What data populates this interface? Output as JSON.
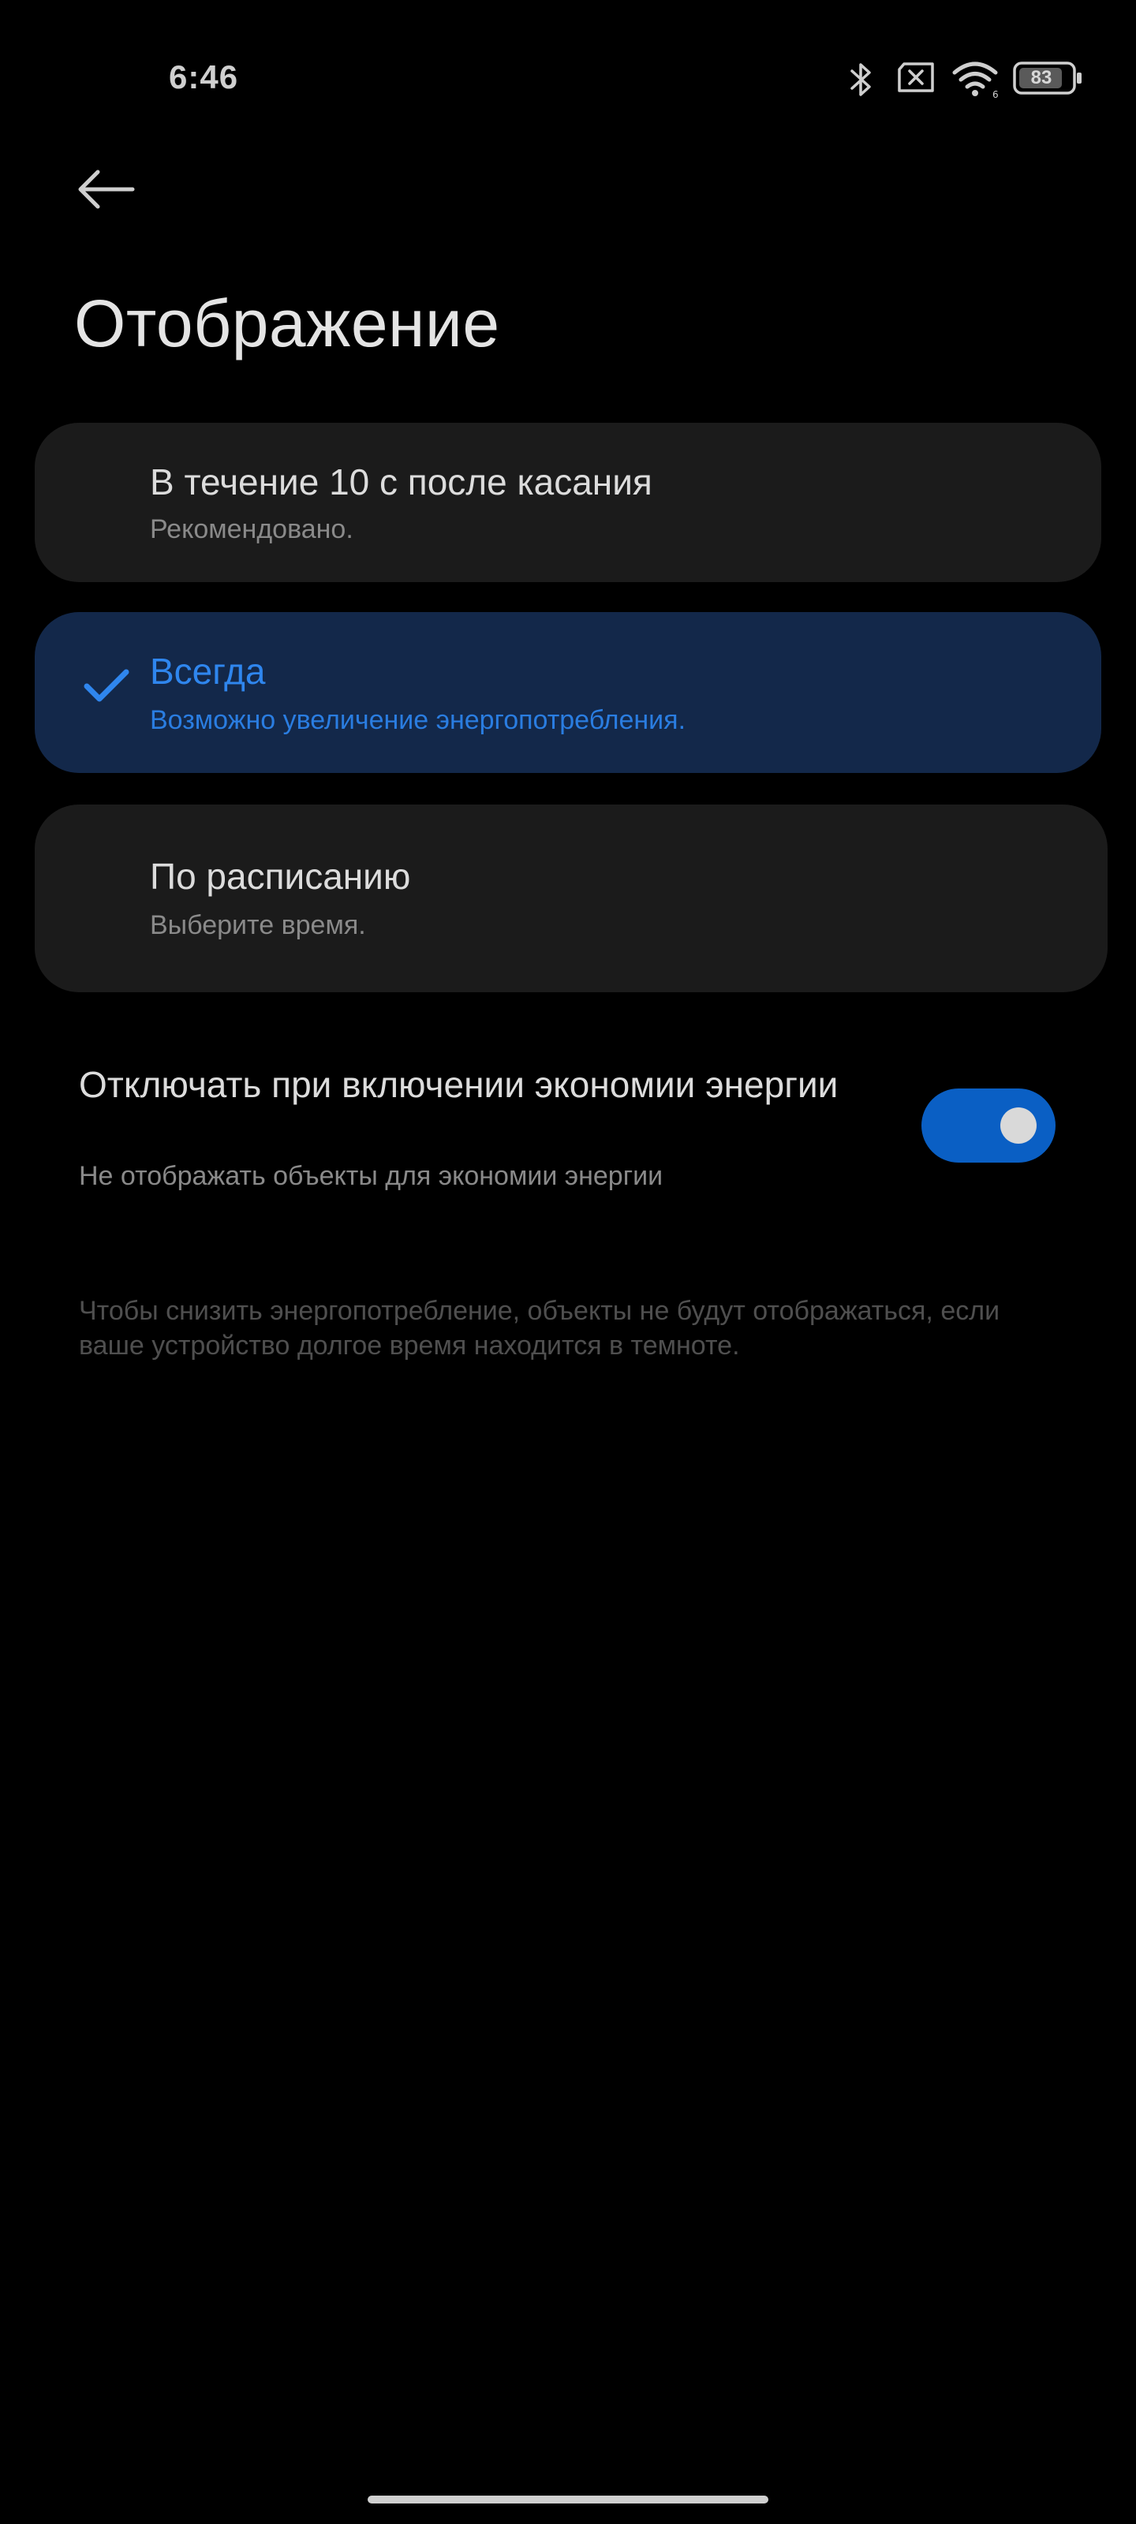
{
  "status_bar": {
    "time": "6:46",
    "battery_level": "83",
    "icons": [
      "bluetooth-icon",
      "no-sim-icon",
      "wifi-icon",
      "battery-icon"
    ]
  },
  "header": {
    "back_icon": "arrow-left-icon",
    "title": "Отображение"
  },
  "options": [
    {
      "title": "В течение 10 с после касания",
      "subtitle": "Рекомендовано.",
      "selected": false
    },
    {
      "title": "Всегда",
      "subtitle": "Возможно увеличение энергопотребления.",
      "selected": true
    },
    {
      "title": "По расписанию",
      "subtitle": "Выберите время.",
      "selected": false
    }
  ],
  "power_saving_toggle": {
    "title": "Отключать при включении экономии энергии",
    "subtitle": "Не отображать объекты для экономии энергии",
    "enabled": true
  },
  "footnote": "Чтобы снизить энергопотребление, объекты не будут отображаться, если ваше устройство долгое время находится в темноте.",
  "colors": {
    "background": "#000000",
    "card": "#1b1b1b",
    "selected_card": "#13284a",
    "accent": "#2f86ee",
    "toggle_on": "#0a5fc4"
  }
}
